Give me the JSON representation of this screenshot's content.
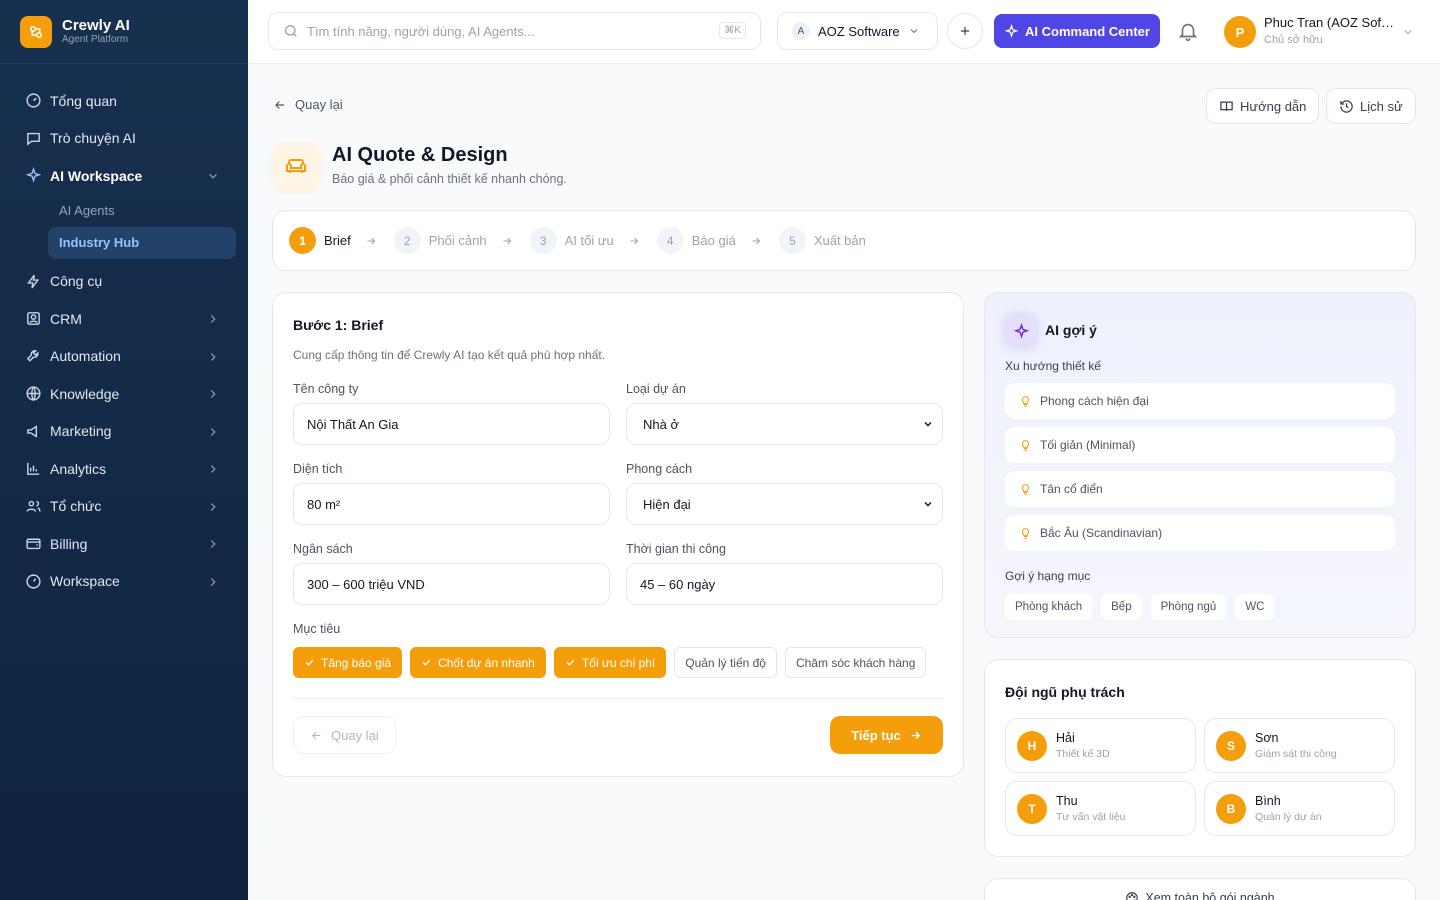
{
  "brand": {
    "name": "Crewly AI",
    "subtitle": "Agent Platform"
  },
  "sidebar": {
    "items": [
      {
        "label": "Tổng quan",
        "icon": "dashboard-icon"
      },
      {
        "label": "Trò chuyện AI",
        "icon": "chat-icon"
      },
      {
        "label": "AI Workspace",
        "icon": "sparkle-icon",
        "expanded": true
      },
      {
        "label": "Công cụ",
        "icon": "bolt-icon"
      },
      {
        "label": "CRM",
        "icon": "contact-icon"
      },
      {
        "label": "Automation",
        "icon": "wrench-icon"
      },
      {
        "label": "Knowledge",
        "icon": "globe-icon"
      },
      {
        "label": "Marketing",
        "icon": "megaphone-icon"
      },
      {
        "label": "Analytics",
        "icon": "bar-chart-icon"
      },
      {
        "label": "Tổ chức",
        "icon": "users-icon"
      },
      {
        "label": "Billing",
        "icon": "wallet-icon"
      },
      {
        "label": "Workspace",
        "icon": "gauge-icon"
      }
    ],
    "subitems": [
      {
        "label": "AI Agents"
      },
      {
        "label": "Industry Hub",
        "active": true
      }
    ]
  },
  "topbar": {
    "search_placeholder": "Tìm tính năng, người dùng, AI Agents...",
    "shortcut": "⌘K",
    "org_initial": "A",
    "org_name": "AOZ Software",
    "ai_button": "AI Command Center",
    "user_initial": "P",
    "user_name": "Phuc Tran (AOZ Software)",
    "user_role": "Chủ sở hữu"
  },
  "header": {
    "back_label": "Quay lại",
    "guide_label": "Hướng dẫn",
    "history_label": "Lịch sử",
    "title": "AI Quote & Design",
    "subtitle": "Báo giá & phối cảnh thiết kế nhanh chóng."
  },
  "steps": [
    {
      "num": "1",
      "label": "Brief",
      "active": true
    },
    {
      "num": "2",
      "label": "Phối cảnh"
    },
    {
      "num": "3",
      "label": "AI tối ưu"
    },
    {
      "num": "4",
      "label": "Báo giá"
    },
    {
      "num": "5",
      "label": "Xuất bản"
    }
  ],
  "brief": {
    "title": "Bước 1: Brief",
    "description": "Cung cấp thông tin để Crewly AI tạo kết quả phù hợp nhất.",
    "company_label": "Tên công ty",
    "company_value": "Nội Thất An Gia",
    "project_label": "Loại dự án",
    "project_value": "Nhà ở",
    "area_label": "Diện tích",
    "area_value": "80 m²",
    "style_label": "Phong cách",
    "style_value": "Hiện đại",
    "budget_label": "Ngân sách",
    "budget_value": "300 – 600 triệu VND",
    "time_label": "Thời gian thi công",
    "time_value": "45 – 60 ngày",
    "goals_label": "Mục tiêu",
    "goals": [
      {
        "label": "Tăng báo giá",
        "selected": true
      },
      {
        "label": "Chốt dự án nhanh",
        "selected": true
      },
      {
        "label": "Tối ưu chi phí",
        "selected": true
      },
      {
        "label": "Quản lý tiến độ",
        "selected": false
      },
      {
        "label": "Chăm sóc khách hàng",
        "selected": false
      }
    ],
    "back_button": "Quay lại",
    "next_button": "Tiếp tục"
  },
  "ai_panel": {
    "title": "AI gợi ý",
    "trends_title": "Xu hướng thiết kế",
    "trends": [
      "Phong cách hiện đại",
      "Tối giản (Minimal)",
      "Tân cổ điển",
      "Bắc Âu (Scandinavian)"
    ],
    "categories_title": "Gợi ý hạng mục",
    "categories": [
      "Phòng khách",
      "Bếp",
      "Phòng ngủ",
      "WC"
    ]
  },
  "team": {
    "title": "Đội ngũ phụ trách",
    "members": [
      {
        "initial": "H",
        "name": "Hải",
        "role": "Thiết kế 3D"
      },
      {
        "initial": "S",
        "name": "Sơn",
        "role": "Giám sát thi công"
      },
      {
        "initial": "T",
        "name": "Thu",
        "role": "Tư vấn vật liệu"
      },
      {
        "initial": "B",
        "name": "Bình",
        "role": "Quản lý dự án"
      }
    ]
  },
  "more_label": "Xem toàn bộ gói ngành",
  "colors": {
    "accent": "#f59e0b",
    "primary": "#4f46e5",
    "sidebar": "#132a47"
  }
}
